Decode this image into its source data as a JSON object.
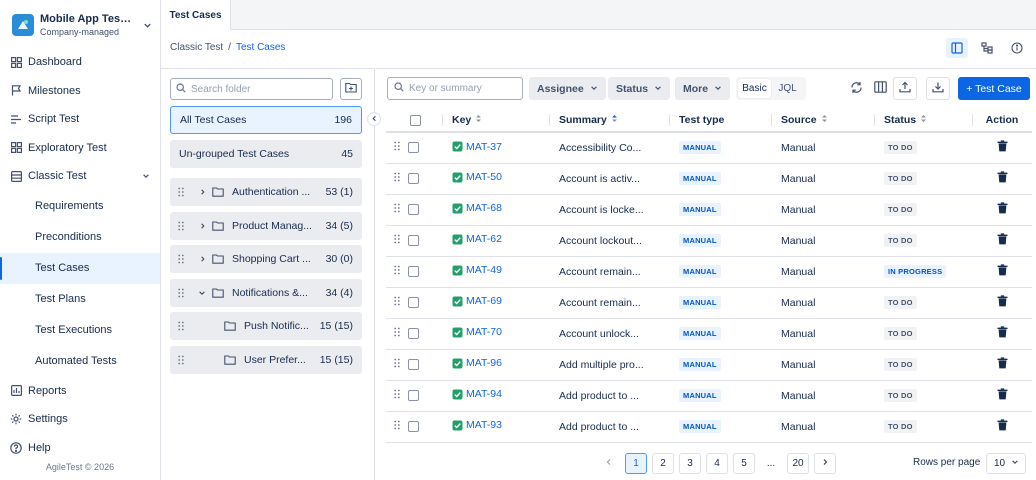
{
  "project": {
    "name": "Mobile App Testi...",
    "type": "Company-managed"
  },
  "nav": {
    "dashboard": "Dashboard",
    "milestones": "Milestones",
    "script_test": "Script Test",
    "exploratory_test": "Exploratory Test",
    "classic_test": "Classic Test",
    "sub": [
      "Requirements",
      "Preconditions",
      "Test Cases",
      "Test Plans",
      "Test Executions",
      "Automated Tests"
    ],
    "reports": "Reports",
    "settings": "Settings",
    "help": "Help"
  },
  "footer": "AgileTest © 2026",
  "tab": "Test Cases",
  "breadcrumb": {
    "parent": "Classic Test",
    "sep": "/",
    "current": "Test Cases"
  },
  "folders": {
    "search_placeholder": "Search folder",
    "all": {
      "label": "All Test Cases",
      "count": "196"
    },
    "ungrouped": {
      "label": "Un-grouped Test Cases",
      "count": "45"
    },
    "items": [
      {
        "name": "Authentication ...",
        "count": "53 (1)",
        "expand": "right"
      },
      {
        "name": "Product Manag...",
        "count": "34 (5)",
        "expand": "right"
      },
      {
        "name": "Shopping Cart ...",
        "count": "30 (0)",
        "expand": "right"
      },
      {
        "name": "Notifications &...",
        "count": "34 (4)",
        "expand": "down"
      },
      {
        "name": "Push Notific...",
        "count": "15 (15)",
        "expand": "none"
      },
      {
        "name": "User Prefer...",
        "count": "15 (15)",
        "expand": "none"
      }
    ]
  },
  "toolbar": {
    "search_placeholder": "Key or summary",
    "assignee": "Assignee",
    "status": "Status",
    "more": "More",
    "basic": "Basic",
    "jql": "JQL",
    "add": "+ Test Case"
  },
  "table": {
    "headers": {
      "key": "Key",
      "summary": "Summary",
      "type": "Test type",
      "source": "Source",
      "status": "Status",
      "action": "Action"
    },
    "rows": [
      {
        "key": "MAT-37",
        "summary": "Accessibility Co...",
        "type": "MANUAL",
        "source": "Manual",
        "status": "TO DO"
      },
      {
        "key": "MAT-50",
        "summary": "Account is activ...",
        "type": "MANUAL",
        "source": "Manual",
        "status": "TO DO"
      },
      {
        "key": "MAT-68",
        "summary": "Account is locke...",
        "type": "MANUAL",
        "source": "Manual",
        "status": "TO DO"
      },
      {
        "key": "MAT-62",
        "summary": "Account lockout...",
        "type": "MANUAL",
        "source": "Manual",
        "status": "TO DO"
      },
      {
        "key": "MAT-49",
        "summary": "Account remain...",
        "type": "MANUAL",
        "source": "Manual",
        "status": "IN PROGRESS"
      },
      {
        "key": "MAT-69",
        "summary": "Account remain...",
        "type": "MANUAL",
        "source": "Manual",
        "status": "TO DO"
      },
      {
        "key": "MAT-70",
        "summary": "Account unlock...",
        "type": "MANUAL",
        "source": "Manual",
        "status": "TO DO"
      },
      {
        "key": "MAT-96",
        "summary": "Add multiple pro...",
        "type": "MANUAL",
        "source": "Manual",
        "status": "TO DO"
      },
      {
        "key": "MAT-94",
        "summary": "Add product to ...",
        "type": "MANUAL",
        "source": "Manual",
        "status": "TO DO"
      },
      {
        "key": "MAT-93",
        "summary": "Add product to ...",
        "type": "MANUAL",
        "source": "Manual",
        "status": "TO DO"
      }
    ]
  },
  "pagination": {
    "pages": [
      "1",
      "2",
      "3",
      "4",
      "5",
      "...",
      "20"
    ],
    "current": "1",
    "rows_label": "Rows per page",
    "rows_value": "10"
  },
  "colors": {
    "primary": "#0c66e4",
    "selected_bg": "#e9f2ff"
  }
}
